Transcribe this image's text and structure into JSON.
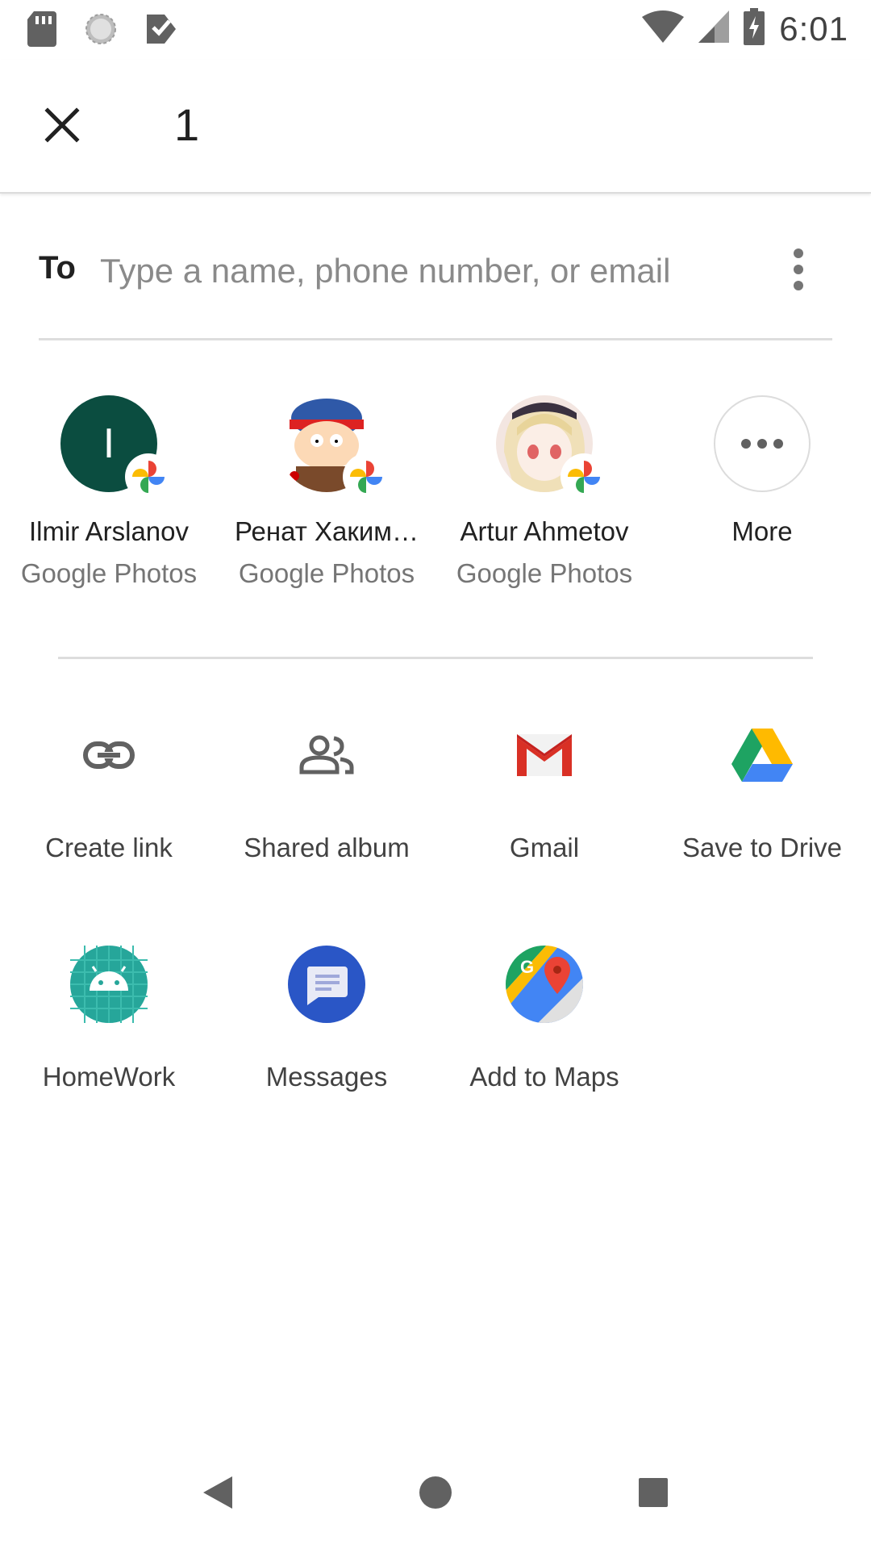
{
  "status_bar": {
    "time": "6:01",
    "left_icons": [
      "sd-card-icon",
      "sync-icon",
      "task-check-icon"
    ],
    "right_icons": [
      "wifi-icon",
      "cell-signal-icon",
      "battery-charging-icon"
    ]
  },
  "app_bar": {
    "close_icon": "close-icon",
    "selection_count": "1"
  },
  "recipient": {
    "label": "To",
    "placeholder": "Type a name, phone number, or email",
    "value": ""
  },
  "people": [
    {
      "name": "Ilmir Arslanov",
      "subtitle": "Google Photos",
      "avatar_letter": "I",
      "avatar_color": "#0b4d40"
    },
    {
      "name": "Ренат Хаким…",
      "subtitle": "Google Photos"
    },
    {
      "name": "Artur Ahmetov",
      "subtitle": "Google Photos"
    },
    {
      "name": "More",
      "subtitle": ""
    }
  ],
  "share_targets": [
    {
      "label": "Create link",
      "icon": "link-icon"
    },
    {
      "label": "Shared album",
      "icon": "people-icon"
    },
    {
      "label": "Gmail",
      "icon": "gmail-icon"
    },
    {
      "label": "Save to Drive",
      "icon": "drive-icon"
    },
    {
      "label": "HomeWork",
      "icon": "android-icon"
    },
    {
      "label": "Messages",
      "icon": "messages-icon"
    },
    {
      "label": "Add to Maps",
      "icon": "maps-icon"
    }
  ],
  "nav_bar": {
    "buttons": [
      "back-icon",
      "home-icon",
      "recents-icon"
    ]
  },
  "colors": {
    "gmail_red": "#d93025",
    "drive_green": "#1ea362",
    "drive_yellow": "#ffba00",
    "drive_blue": "#4285f4",
    "messages_blue": "#2a56c6",
    "android_teal": "#26a69a"
  }
}
